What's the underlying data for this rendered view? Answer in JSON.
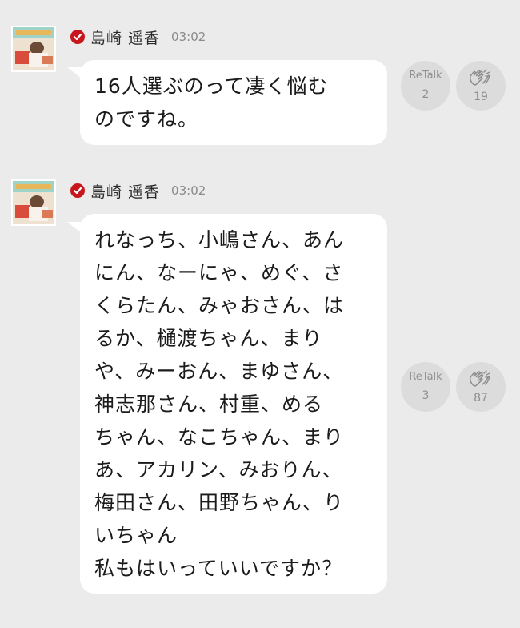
{
  "posts": [
    {
      "author": "島崎 遥香",
      "time": "03:02",
      "text": "16人選ぶのって凄く悩む\nのですね。",
      "retalk_label": "ReTalk",
      "retalk_count": "2",
      "clap_count": "19",
      "clap_icon": "clapping-hands-icon"
    },
    {
      "author": "島崎 遥香",
      "time": "03:02",
      "text": "れなっち、小嶋さん、あん\nにん、なーにゃ、めぐ、さ\nくらたん、みゃおさん、は\nるか、樋渡ちゃん、まり\nや、みーおん、まゆさん、\n神志那さん、村重、める\nちゃん、なこちゃん、まり\nあ、アカリン、みおりん、\n梅田さん、田野ちゃん、り\nいちゃん\n私もはいっていいですか？",
      "retalk_label": "ReTalk",
      "retalk_count": "3",
      "clap_count": "87",
      "clap_icon": "clapping-hands-icon"
    }
  ],
  "colors": {
    "background": "#ebebeb",
    "bubble": "#ffffff",
    "verified": "#c8161d",
    "action_bg": "#dcdcdc"
  }
}
